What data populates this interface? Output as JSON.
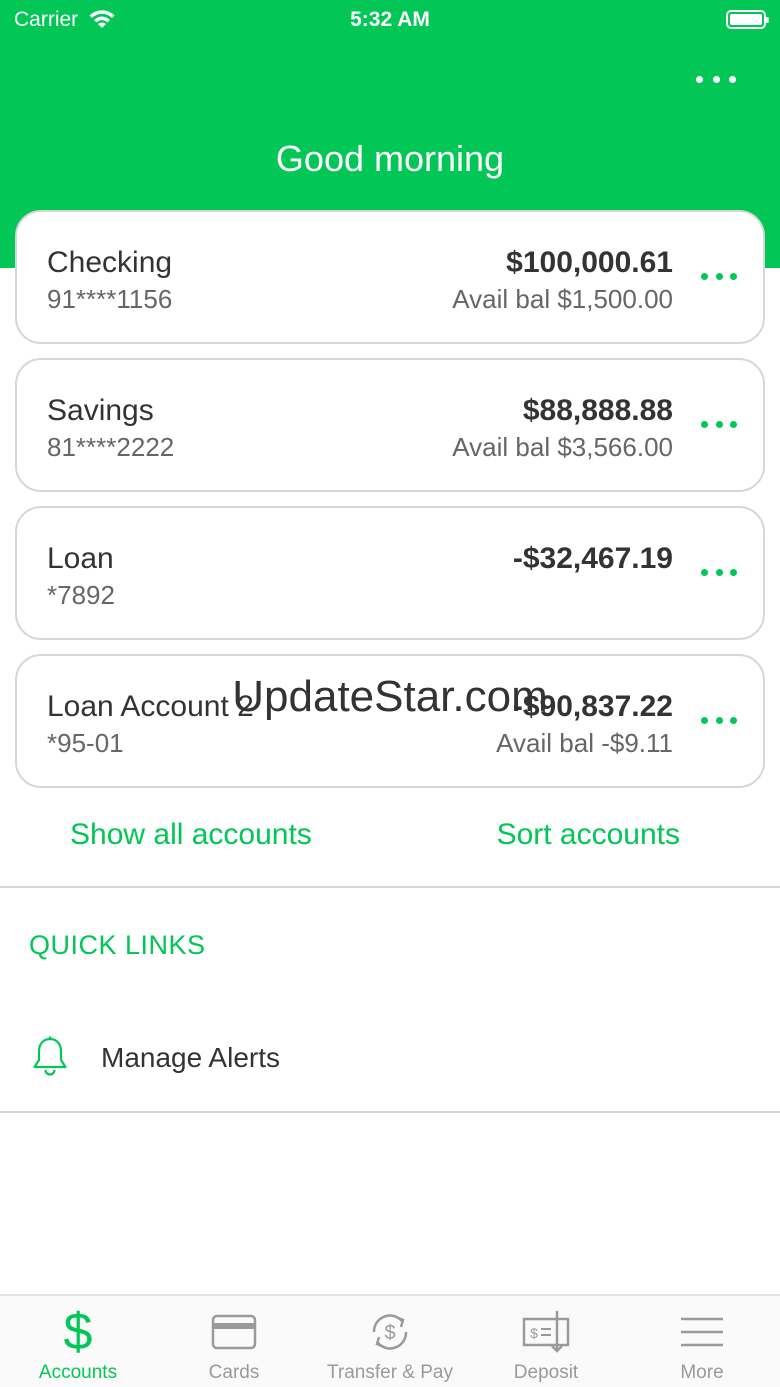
{
  "status_bar": {
    "carrier": "Carrier",
    "time": "5:32 AM"
  },
  "header": {
    "greeting": "Good morning"
  },
  "accounts": [
    {
      "name": "Checking",
      "number": "91****1156",
      "balance": "$100,000.61",
      "available": "Avail bal $1,500.00"
    },
    {
      "name": "Savings",
      "number": "81****2222",
      "balance": "$88,888.88",
      "available": "Avail bal $3,566.00"
    },
    {
      "name": "Loan",
      "number": "*7892",
      "balance": "-$32,467.19",
      "available": ""
    },
    {
      "name": "Loan Account 2",
      "number": "*95-01",
      "balance": "-$90,837.22",
      "available": "Avail bal -$9.11"
    }
  ],
  "links": {
    "show_all": "Show all accounts",
    "sort": "Sort accounts"
  },
  "quick_links": {
    "title": "QUICK LINKS",
    "items": [
      {
        "label": "Manage Alerts",
        "icon": "bell-icon"
      }
    ]
  },
  "watermark": "UpdateStar.com",
  "tabbar": {
    "tabs": [
      {
        "label": "Accounts",
        "icon": "dollar-icon",
        "active": true
      },
      {
        "label": "Cards",
        "icon": "card-icon",
        "active": false
      },
      {
        "label": "Transfer & Pay",
        "icon": "transfer-icon",
        "active": false
      },
      {
        "label": "Deposit",
        "icon": "check-deposit-icon",
        "active": false
      },
      {
        "label": "More",
        "icon": "menu-icon",
        "active": false
      }
    ]
  },
  "colors": {
    "brand_green": "#02c655",
    "text_dark": "#333333",
    "text_muted": "#666666",
    "tab_inactive": "#9a9a9a"
  }
}
